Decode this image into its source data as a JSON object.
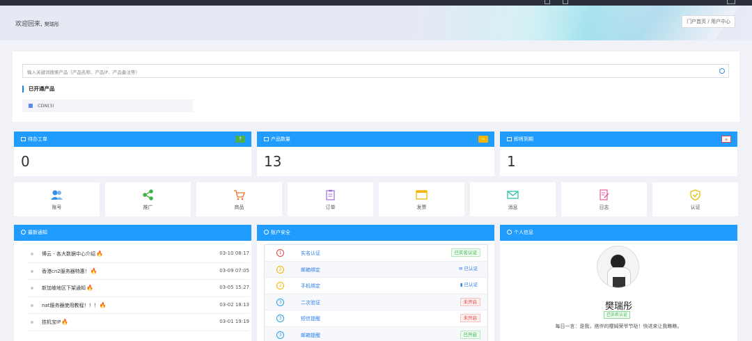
{
  "header": {
    "welcome": "欢迎回来, ",
    "username": "樊瑞彤",
    "breadcrumb": "门户首页 / 用户中心"
  },
  "search": {
    "placeholder": "输入关键词搜索产品（产品名称、产品IP、产品备注等）"
  },
  "opened_products": {
    "title": "已开通产品",
    "items": [
      {
        "label": "CDN(3)"
      }
    ]
  },
  "stats": [
    {
      "label": "待办工单",
      "value": "0",
      "badge_color": "#4caf50"
    },
    {
      "label": "产品数量",
      "value": "13",
      "badge_color": "#f5b400"
    },
    {
      "label": "即将到期",
      "value": "1",
      "badge_color": "#e84545"
    }
  ],
  "shortcuts": [
    {
      "label": "账号",
      "icon": "users-icon",
      "color": "#3a8ee6"
    },
    {
      "label": "推广",
      "icon": "share-icon",
      "color": "#3cb24a"
    },
    {
      "label": "商品",
      "icon": "cart-icon",
      "color": "#f37021"
    },
    {
      "label": "订单",
      "icon": "clipboard-icon",
      "color": "#a56cdb"
    },
    {
      "label": "发票",
      "icon": "invoice-icon",
      "color": "#f5b400"
    },
    {
      "label": "消息",
      "icon": "mail-icon",
      "color": "#29c2a6"
    },
    {
      "label": "日志",
      "icon": "log-icon",
      "color": "#e8579c"
    },
    {
      "label": "认证",
      "icon": "shield-check-icon",
      "color": "#e2c100"
    }
  ],
  "notices": {
    "title": "最新通知",
    "items": [
      {
        "text": "博云 - 各大数据中心介绍",
        "date": "03-10 08:17"
      },
      {
        "text": "香港cn2服务器特惠！",
        "date": "03-09 07:05"
      },
      {
        "text": "新加坡地区下架通知",
        "date": "03-05 15:27"
      },
      {
        "text": "nat服务器使用教程！！！",
        "date": "03-02 18:13"
      },
      {
        "text": "挂机宝IP",
        "date": "03-01 19:19"
      }
    ]
  },
  "security": {
    "title": "账户安全",
    "items": [
      {
        "num": "1",
        "label": "实名认证",
        "status": "已实名认证",
        "status_type": "green",
        "circle_color": "#e84545"
      },
      {
        "num": "2",
        "label": "邮箱绑定",
        "status": "已认证",
        "status_type": "blue",
        "circle_color": "#f5b400"
      },
      {
        "num": "2",
        "label": "手机绑定",
        "status": "已认证",
        "status_type": "blue",
        "circle_color": "#f5b400"
      },
      {
        "num": "3",
        "label": "二次验证",
        "status": "未开启",
        "status_type": "red",
        "circle_color": "#29a0e6"
      },
      {
        "num": "3",
        "label": "短信提醒",
        "status": "未开启",
        "status_type": "red",
        "circle_color": "#29a0e6"
      },
      {
        "num": "3",
        "label": "邮箱提醒",
        "status": "已开启",
        "status_type": "green",
        "circle_color": "#29a0e6"
      }
    ]
  },
  "profile": {
    "title": "个人信息",
    "name": "樊瑞彤",
    "verified": "已实名认证",
    "motto": "每日一言：是我，搭伴的樱姆荣爷节哒！快进来让我瞧瞧。"
  }
}
